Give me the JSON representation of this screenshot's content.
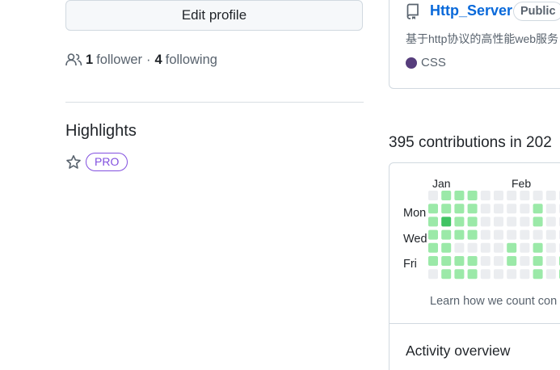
{
  "profile": {
    "edit_button": "Edit profile",
    "followers_count": "1",
    "followers_label": "follower",
    "separator": "·",
    "following_count": "4",
    "following_label": "following"
  },
  "highlights": {
    "title": "Highlights",
    "badge": "PRO"
  },
  "pinned_repo": {
    "name": "Http_Server",
    "visibility": "Public",
    "description": "基于http协议的高性能web服务",
    "language": "CSS",
    "language_color": "#563d7c"
  },
  "contributions": {
    "title": "395 contributions in 202",
    "months": [
      "Jan",
      "Feb"
    ],
    "days": [
      "Mon",
      "Wed",
      "Fri"
    ],
    "learn_link": "Learn how we count con",
    "colors": [
      "#ebedf0",
      "#9be9a8",
      "#40c463",
      "#30a14e"
    ],
    "levels": [
      [
        0,
        1,
        1,
        1,
        1,
        1,
        0
      ],
      [
        1,
        1,
        2,
        1,
        1,
        1,
        1
      ],
      [
        1,
        1,
        1,
        1,
        0,
        1,
        1
      ],
      [
        1,
        1,
        1,
        1,
        0,
        1,
        1
      ],
      [
        0,
        0,
        0,
        0,
        0,
        0,
        0
      ],
      [
        0,
        0,
        0,
        0,
        0,
        0,
        0
      ],
      [
        0,
        0,
        0,
        0,
        1,
        1,
        0
      ],
      [
        0,
        0,
        0,
        0,
        0,
        0,
        0
      ],
      [
        0,
        1,
        1,
        0,
        1,
        1,
        1
      ],
      [
        0,
        0,
        0,
        0,
        0,
        0,
        0
      ],
      [
        0,
        0,
        0,
        0,
        0,
        1,
        1
      ]
    ]
  },
  "activity": {
    "title": "Activity overview"
  }
}
